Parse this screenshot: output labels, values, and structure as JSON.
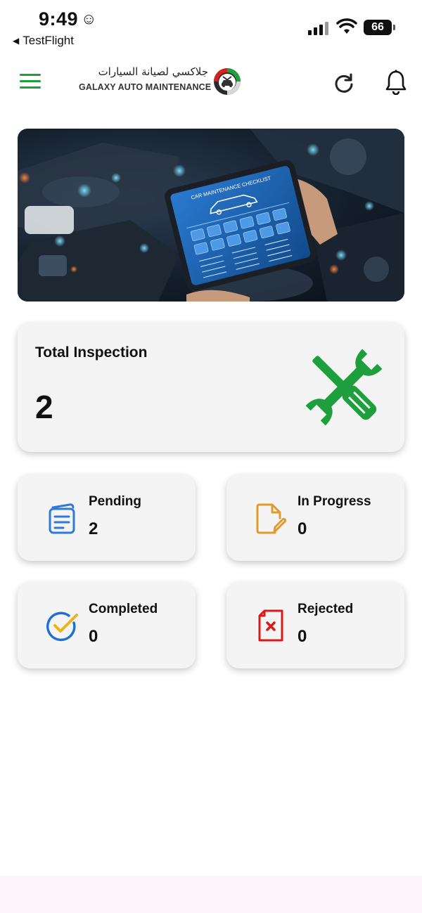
{
  "status_bar": {
    "time": "9:49",
    "time_emoji": "☺",
    "back_app": "TestFlight",
    "battery": "66"
  },
  "header": {
    "brand_arabic": "جلاكسي لصيانة السيارات",
    "brand_english": "GALAXY AUTO MAINTENANCE",
    "accent_color": "#1e9e3d"
  },
  "hero": {
    "tablet_title": "CAR MAINTENANCE CHECKLIST"
  },
  "total": {
    "title": "Total Inspection",
    "value": "2"
  },
  "stats": {
    "pending": {
      "title": "Pending",
      "value": "2",
      "color": "#2f7ad6"
    },
    "in_progress": {
      "title": "In Progress",
      "value": "0",
      "color": "#e29a2b"
    },
    "completed": {
      "title": "Completed",
      "value": "0",
      "color": "#1f6fd8"
    },
    "rejected": {
      "title": "Rejected",
      "value": "0",
      "color": "#d91a1a"
    }
  }
}
